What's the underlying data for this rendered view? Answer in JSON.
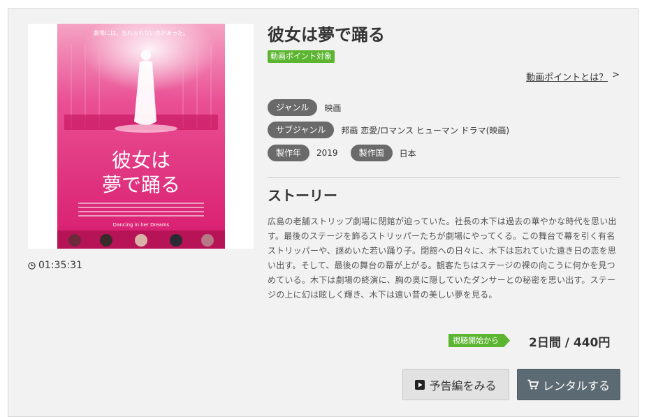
{
  "movie": {
    "title": "彼女は夢で踊る",
    "point_badge": "動画ポイント対象",
    "point_link": "動画ポイントとは？",
    "point_link_arrow": ">",
    "duration": "01:35:31",
    "poster": {
      "tagline": "劇場には、忘れられない恋があった。",
      "title_line1": "彼女は",
      "title_line2": "夢で踊る",
      "subtitle": "Dancing in her Dreams"
    }
  },
  "meta": {
    "genre_label": "ジャンル",
    "genre_value": "映画",
    "subgenre_label": "サブジャンル",
    "subgenre_value": "邦画 恋愛/ロマンス ヒューマン ドラマ(映画)",
    "year_label": "製作年",
    "year_value": "2019",
    "country_label": "製作国",
    "country_value": "日本"
  },
  "story": {
    "heading": "ストーリー",
    "text": "広島の老舗ストリップ劇場に閉館が迫っていた。社長の木下は過去の華やかな時代を思い出す。最後のステージを飾るストリッパーたちが劇場にやってくる。この舞台で幕を引く有名ストリッパーや、謎めいた若い踊り子。閉館への日々に、木下は忘れていた遠き日の恋を思い出す。そして、最後の舞台の幕が上がる。観客たちはステージの裸の向こうに何かを見つめている。木下は劇場の終演に、胸の奥に隠していたダンサーとの秘密を思い出す。ステージの上に幻は眩しく輝き、木下は遠い昔の美しい夢を見る。"
  },
  "rental": {
    "start_badge": "視聴開始から",
    "price": "2日間 / 440円"
  },
  "buttons": {
    "trailer": "予告編をみる",
    "rent": "レンタルする"
  },
  "colors": {
    "accent_green": "#5cb531",
    "tag_gray": "#6a6a6a",
    "rent_button": "#5c6b73",
    "poster_pink": "#e0237a"
  }
}
